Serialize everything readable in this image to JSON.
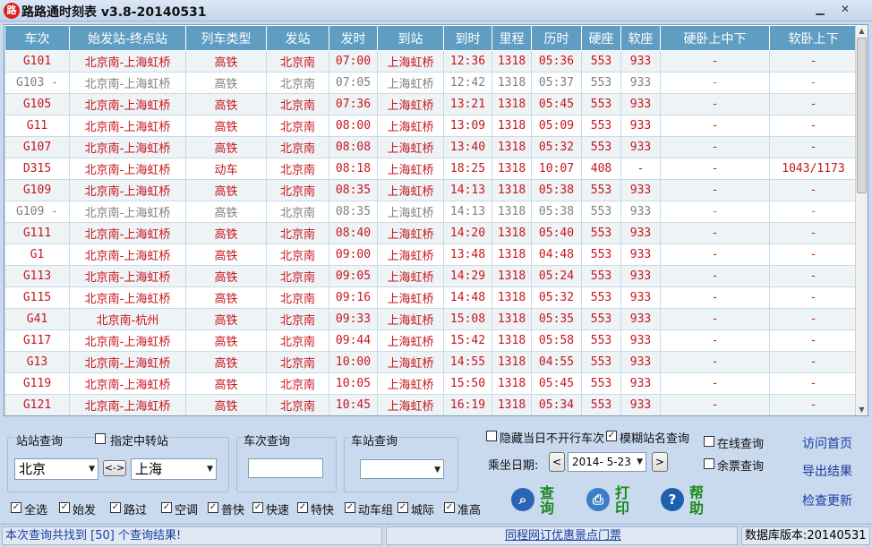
{
  "window": {
    "title": "路路通时刻表 v3.8-20140531",
    "icon_text": "路",
    "minimize_label": "▁",
    "close_label": "✕"
  },
  "table": {
    "columns": [
      "车次",
      "始发站-终点站",
      "列车类型",
      "发站",
      "发时",
      "到站",
      "到时",
      "里程",
      "历时",
      "硬座",
      "软座",
      "硬卧上中下",
      "软卧上下"
    ],
    "rows": [
      {
        "style": "red",
        "cells": [
          "G101",
          "北京南-上海虹桥",
          "高铁",
          "北京南",
          "07:00",
          "上海虹桥",
          "12:36",
          "1318",
          "05:36",
          "553",
          "933",
          "-",
          "-"
        ]
      },
      {
        "style": "gray",
        "cells": [
          "G103 -",
          "北京南-上海虹桥",
          "高铁",
          "北京南",
          "07:05",
          "上海虹桥",
          "12:42",
          "1318",
          "05:37",
          "553",
          "933",
          "-",
          "-"
        ]
      },
      {
        "style": "red",
        "cells": [
          "G105",
          "北京南-上海虹桥",
          "高铁",
          "北京南",
          "07:36",
          "上海虹桥",
          "13:21",
          "1318",
          "05:45",
          "553",
          "933",
          "-",
          "-"
        ]
      },
      {
        "style": "red",
        "cells": [
          "G11",
          "北京南-上海虹桥",
          "高铁",
          "北京南",
          "08:00",
          "上海虹桥",
          "13:09",
          "1318",
          "05:09",
          "553",
          "933",
          "-",
          "-"
        ]
      },
      {
        "style": "red",
        "cells": [
          "G107",
          "北京南-上海虹桥",
          "高铁",
          "北京南",
          "08:08",
          "上海虹桥",
          "13:40",
          "1318",
          "05:32",
          "553",
          "933",
          "-",
          "-"
        ]
      },
      {
        "style": "red",
        "cells": [
          "D315",
          "北京南-上海虹桥",
          "动车",
          "北京南",
          "08:18",
          "上海虹桥",
          "18:25",
          "1318",
          "10:07",
          "408",
          "-",
          "-",
          "1043/1173"
        ]
      },
      {
        "style": "red",
        "cells": [
          "G109",
          "北京南-上海虹桥",
          "高铁",
          "北京南",
          "08:35",
          "上海虹桥",
          "14:13",
          "1318",
          "05:38",
          "553",
          "933",
          "-",
          "-"
        ]
      },
      {
        "style": "gray",
        "cells": [
          "G109 -",
          "北京南-上海虹桥",
          "高铁",
          "北京南",
          "08:35",
          "上海虹桥",
          "14:13",
          "1318",
          "05:38",
          "553",
          "933",
          "-",
          "-"
        ]
      },
      {
        "style": "red",
        "cells": [
          "G111",
          "北京南-上海虹桥",
          "高铁",
          "北京南",
          "08:40",
          "上海虹桥",
          "14:20",
          "1318",
          "05:40",
          "553",
          "933",
          "-",
          "-"
        ]
      },
      {
        "style": "red",
        "cells": [
          "G1",
          "北京南-上海虹桥",
          "高铁",
          "北京南",
          "09:00",
          "上海虹桥",
          "13:48",
          "1318",
          "04:48",
          "553",
          "933",
          "-",
          "-"
        ]
      },
      {
        "style": "red",
        "cells": [
          "G113",
          "北京南-上海虹桥",
          "高铁",
          "北京南",
          "09:05",
          "上海虹桥",
          "14:29",
          "1318",
          "05:24",
          "553",
          "933",
          "-",
          "-"
        ]
      },
      {
        "style": "red",
        "cells": [
          "G115",
          "北京南-上海虹桥",
          "高铁",
          "北京南",
          "09:16",
          "上海虹桥",
          "14:48",
          "1318",
          "05:32",
          "553",
          "933",
          "-",
          "-"
        ]
      },
      {
        "style": "red",
        "cells": [
          "G41",
          "北京南-杭州",
          "高铁",
          "北京南",
          "09:33",
          "上海虹桥",
          "15:08",
          "1318",
          "05:35",
          "553",
          "933",
          "-",
          "-"
        ]
      },
      {
        "style": "red",
        "cells": [
          "G117",
          "北京南-上海虹桥",
          "高铁",
          "北京南",
          "09:44",
          "上海虹桥",
          "15:42",
          "1318",
          "05:58",
          "553",
          "933",
          "-",
          "-"
        ]
      },
      {
        "style": "red",
        "cells": [
          "G13",
          "北京南-上海虹桥",
          "高铁",
          "北京南",
          "10:00",
          "上海虹桥",
          "14:55",
          "1318",
          "04:55",
          "553",
          "933",
          "-",
          "-"
        ]
      },
      {
        "style": "red",
        "cells": [
          "G119",
          "北京南-上海虹桥",
          "高铁",
          "北京南",
          "10:05",
          "上海虹桥",
          "15:50",
          "1318",
          "05:45",
          "553",
          "933",
          "-",
          "-"
        ]
      },
      {
        "style": "red",
        "cells": [
          "G121",
          "北京南-上海虹桥",
          "高铁",
          "北京南",
          "10:45",
          "上海虹桥",
          "16:19",
          "1318",
          "05:34",
          "553",
          "933",
          "-",
          "-"
        ]
      }
    ]
  },
  "station_query": {
    "label": "站站查询",
    "transfer_label": "指定中转站",
    "from_value": "北京",
    "to_value": "上海",
    "swap_label": "<->"
  },
  "train_query": {
    "label": "车次查询",
    "value": ""
  },
  "station_only_query": {
    "label": "车站查询",
    "value": ""
  },
  "filters": {
    "hide_not_running": {
      "label": "隐藏当日不开行车次",
      "checked": false
    },
    "fuzzy_station": {
      "label": "模糊站名查询",
      "checked": true
    },
    "online_query": {
      "label": "在线查询",
      "checked": false
    },
    "ticket_query": {
      "label": "余票查询",
      "checked": false
    }
  },
  "date": {
    "label": "乘坐日期:",
    "value": "2014- 5-23",
    "prev": "<",
    "next": ">"
  },
  "type_filters": [
    {
      "label": "全选",
      "checked": true
    },
    {
      "label": "始发",
      "checked": true
    },
    {
      "label": "路过",
      "checked": true
    },
    {
      "label": "空调",
      "checked": true
    },
    {
      "label": "普快",
      "checked": true
    },
    {
      "label": "快速",
      "checked": true
    },
    {
      "label": "特快",
      "checked": true
    },
    {
      "label": "动车组",
      "checked": true
    },
    {
      "label": "城际",
      "checked": true
    },
    {
      "label": "准高",
      "checked": true
    }
  ],
  "actions": {
    "query": "查询",
    "print": "打印",
    "help": "帮助"
  },
  "links": {
    "home": "访问首页",
    "export": "导出结果",
    "update": "检查更新"
  },
  "status": {
    "result_text": "本次查询共找到 [50] 个查询结果!",
    "ad_text": "同程网订优惠景点门票",
    "db_version": "数据库版本:20140531"
  },
  "colors": {
    "header_bg": "#5f9ec2",
    "red_text": "#c8161d",
    "gray_text": "#808080"
  }
}
